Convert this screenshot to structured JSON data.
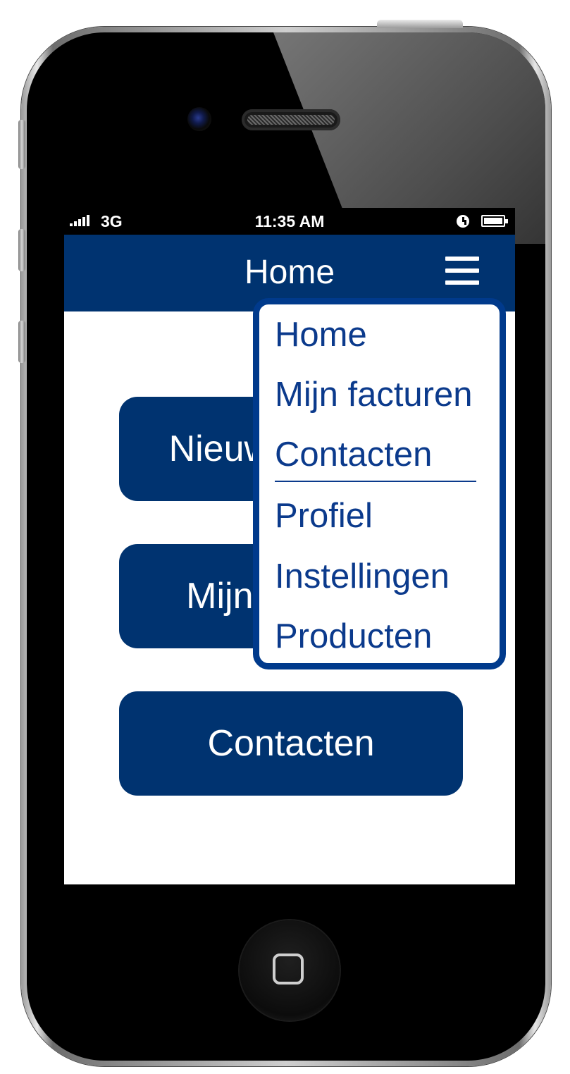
{
  "status_bar": {
    "network": "3G",
    "time": "11:35 AM"
  },
  "navbar": {
    "title": "Home"
  },
  "buttons": [
    "Nieuwe factuur",
    "Mijn facturen",
    "Contacten"
  ],
  "menu": {
    "items": [
      "Home",
      "Mijn facturen",
      "Contacten",
      "Profiel",
      "Instellingen",
      "Producten"
    ]
  },
  "colors": {
    "brand": "#003370",
    "menu_border": "#003a8c",
    "menu_text": "#0b3a8c",
    "screen_bg": "#ffffff"
  },
  "icons": {
    "menu": "hamburger-menu-icon",
    "signal": "signal-strength-icon",
    "battery": "battery-icon",
    "alarm": "alarm-icon"
  }
}
